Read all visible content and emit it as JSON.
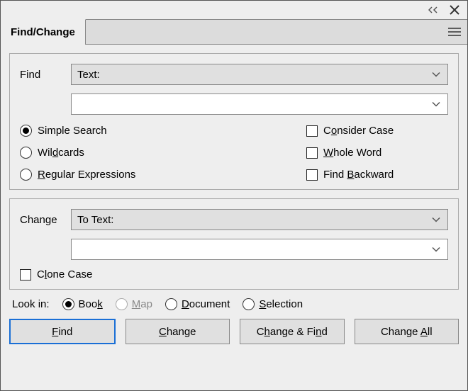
{
  "header": {
    "title": "Find/Change"
  },
  "find": {
    "label": "Find",
    "type_label": "Text:",
    "value": "",
    "options": {
      "simple": "Simple Search",
      "wildcards": "Wildcards",
      "regex": "Regular Expressions",
      "consider_case_pre": "C",
      "consider_case_ul": "o",
      "consider_case_post": "nsider Case",
      "whole_word_ul": "W",
      "whole_word_post": "hole Word",
      "find_backward_pre": "Find ",
      "find_backward_ul": "B",
      "find_backward_post": "ackward"
    }
  },
  "change": {
    "label": "Change",
    "type_label": "To Text:",
    "value": "",
    "clone_case_pre": "C",
    "clone_case_ul": "l",
    "clone_case_post": "one Case"
  },
  "lookin": {
    "label": "Look in:",
    "book": "Boo",
    "book_ul": "k",
    "map_ul": "M",
    "map_post": "ap",
    "document_ul": "D",
    "document_post": "ocument",
    "selection_ul": "S",
    "selection_post": "election"
  },
  "buttons": {
    "find_ul": "F",
    "find_post": "ind",
    "change_ul": "C",
    "change_post": "hange",
    "change_find_pre1": "C",
    "change_find_ul1": "h",
    "change_find_post1": "ange & Fi",
    "change_find_ul2": "n",
    "change_find_post2": "d",
    "change_all_pre": "Change ",
    "change_all_ul": "A",
    "change_all_post": "ll"
  }
}
